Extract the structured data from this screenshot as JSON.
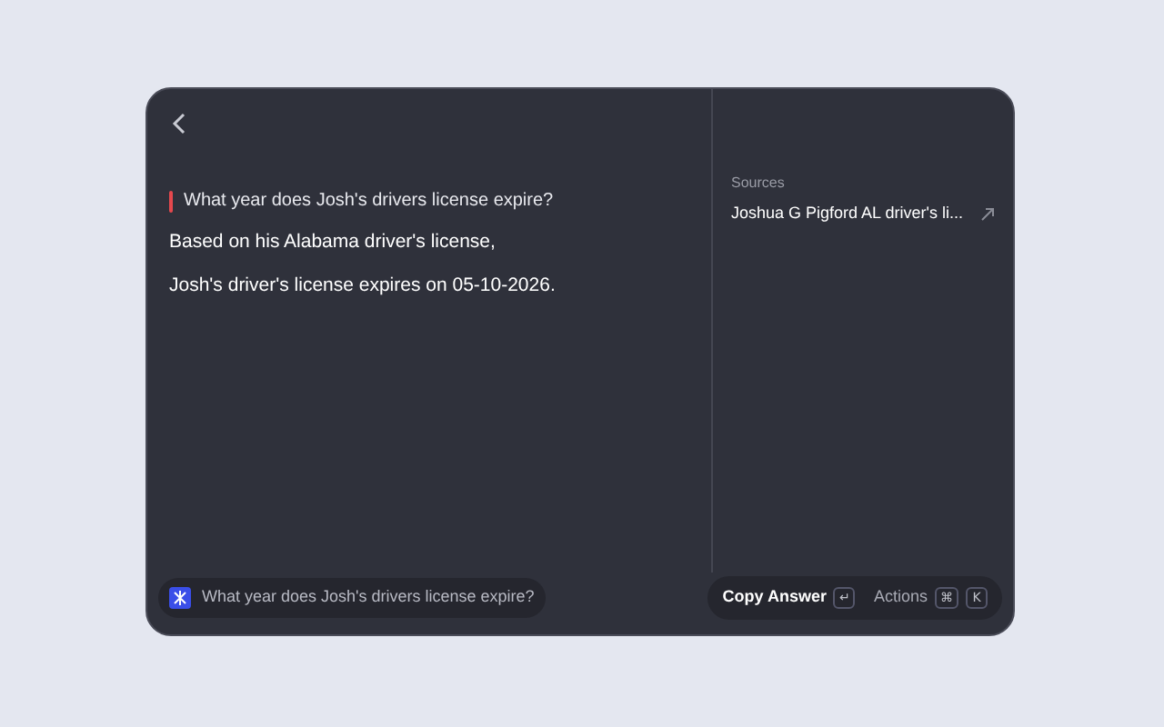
{
  "question": "What year does Josh's drivers license expire?",
  "answer": [
    "Based on his Alabama driver's license,",
    "Josh's driver's license expires on 05-10-2026."
  ],
  "sources": {
    "heading": "Sources",
    "items": [
      {
        "title": "Joshua G Pigford AL driver's li..."
      }
    ]
  },
  "search": {
    "value": "What year does Josh's drivers license expire?"
  },
  "actions": [
    {
      "label": "Copy Answer",
      "keys": [
        "↵"
      ],
      "primary": true
    },
    {
      "label": "Actions",
      "keys": [
        "⌘",
        "K"
      ],
      "primary": false
    }
  ]
}
